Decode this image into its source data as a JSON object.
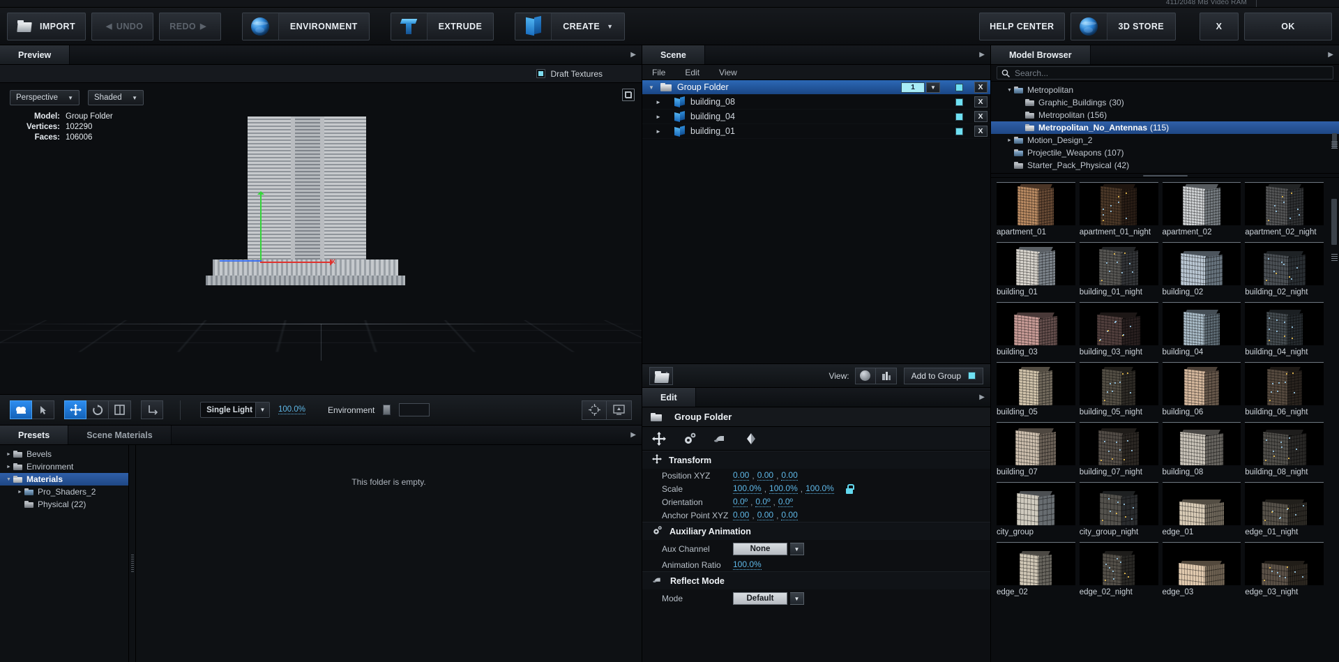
{
  "app": {
    "vram": "411/2048 MB Video RAM"
  },
  "toolbar": {
    "import": "IMPORT",
    "undo": "UNDO",
    "redo": "REDO",
    "environment": "ENVIRONMENT",
    "extrude": "EXTRUDE",
    "create": "CREATE",
    "help_center": "HELP CENTER",
    "store": "3D STORE",
    "close": "X",
    "ok": "OK"
  },
  "preview": {
    "tab": "Preview",
    "draft_textures": "Draft Textures",
    "camera_mode": "Perspective",
    "shading_mode": "Shaded",
    "stats": [
      {
        "key": "Model:",
        "value": "Group Folder"
      },
      {
        "key": "Vertices:",
        "value": "102290"
      },
      {
        "key": "Faces:",
        "value": "106006"
      }
    ],
    "tools": {
      "camera": "camera-tool",
      "select": "select-tool",
      "move": "move-tool",
      "rotate": "rotate-tool",
      "scale": "scale-tool",
      "axis": "axis-tool"
    },
    "light_mode": "Single Light",
    "light_intensity": "100.0%",
    "environment_label": "Environment"
  },
  "scene": {
    "tab": "Scene",
    "menu": [
      "File",
      "Edit",
      "View"
    ],
    "rows": [
      {
        "name": "Group Folder",
        "type": "folder",
        "selected": true,
        "count": "1",
        "has_count": true,
        "indent": 0,
        "expanded": true
      },
      {
        "name": "building_08",
        "type": "mesh",
        "selected": false,
        "has_count": false,
        "indent": 1,
        "expanded": false
      },
      {
        "name": "building_04",
        "type": "mesh",
        "selected": false,
        "has_count": false,
        "indent": 1,
        "expanded": false
      },
      {
        "name": "building_01",
        "type": "mesh",
        "selected": false,
        "has_count": false,
        "indent": 1,
        "expanded": false
      }
    ],
    "close_label": "X",
    "footer": {
      "view_label": "View:",
      "add_to_group": "Add to Group"
    }
  },
  "edit": {
    "tab": "Edit",
    "object_name": "Group Folder",
    "sections": [
      {
        "title": "Transform",
        "icon": "move-icon",
        "rows": [
          {
            "label": "Position XYZ",
            "values": [
              "0.00",
              "0.00",
              "0.00"
            ],
            "suffix": "",
            "lock": false
          },
          {
            "label": "Scale",
            "values": [
              "100.0%",
              "100.0%",
              "100.0%"
            ],
            "suffix": "",
            "lock": true
          },
          {
            "label": "Orientation",
            "values": [
              "0.0º",
              "0.0º",
              "0.0º"
            ],
            "suffix": "",
            "lock": false
          },
          {
            "label": "Anchor Point XYZ",
            "values": [
              "0.00",
              "0.00",
              "0.00"
            ],
            "suffix": "",
            "lock": false
          }
        ]
      },
      {
        "title": "Auxiliary Animation",
        "icon": "gears-icon",
        "dropdown_row": {
          "label": "Aux Channel",
          "value": "None"
        },
        "link_row": {
          "label": "Animation Ratio",
          "value": "100.0%"
        }
      },
      {
        "title": "Reflect Mode",
        "icon": "reflect-icon",
        "dropdown_row": {
          "label": "Mode",
          "value": "Default"
        }
      }
    ]
  },
  "presets": {
    "tabs": [
      {
        "label": "Presets",
        "active": true
      },
      {
        "label": "Scene Materials",
        "active": false
      }
    ],
    "tree": [
      {
        "label": "Bevels",
        "indent": 0,
        "arrow": "right",
        "selected": false,
        "folder": "grey"
      },
      {
        "label": "Environment",
        "indent": 0,
        "arrow": "right",
        "selected": false,
        "folder": "grey"
      },
      {
        "label": "Materials",
        "indent": 0,
        "arrow": "down",
        "selected": true,
        "folder": "open"
      },
      {
        "label": "Pro_Shaders_2",
        "indent": 1,
        "arrow": "right",
        "selected": false,
        "folder": "blue"
      },
      {
        "label": "Physical (22)",
        "indent": 1,
        "arrow": "none",
        "selected": false,
        "folder": "grey"
      }
    ],
    "empty_message": "This folder is empty."
  },
  "model_browser": {
    "tab": "Model Browser",
    "search_placeholder": "Search...",
    "search_value": "",
    "tree": [
      {
        "label": "Metropolitan",
        "count": "",
        "indent": 1,
        "arrow": "down",
        "selected": false,
        "folder": "blue"
      },
      {
        "label": "Graphic_Buildings",
        "count": "(30)",
        "indent": 2,
        "arrow": "none",
        "selected": false,
        "folder": "grey"
      },
      {
        "label": "Metropolitan",
        "count": "(156)",
        "indent": 2,
        "arrow": "none",
        "selected": false,
        "folder": "grey"
      },
      {
        "label": "Metropolitan_No_Antennas",
        "count": "(115)",
        "indent": 2,
        "arrow": "none",
        "selected": true,
        "folder": "open"
      },
      {
        "label": "Motion_Design_2",
        "count": "",
        "indent": 1,
        "arrow": "right",
        "selected": false,
        "folder": "blue"
      },
      {
        "label": "Projectile_Weapons",
        "count": "(107)",
        "indent": 1,
        "arrow": "none",
        "selected": false,
        "folder": "blue"
      },
      {
        "label": "Starter_Pack_Physical",
        "count": "(42)",
        "indent": 1,
        "arrow": "none",
        "selected": false,
        "folder": "grey"
      }
    ],
    "items": [
      {
        "label": "apartment_01",
        "night": false,
        "style": "brick-tall"
      },
      {
        "label": "apartment_01_night",
        "night": true,
        "style": "brick-tall"
      },
      {
        "label": "apartment_02",
        "night": false,
        "style": "pale-tall"
      },
      {
        "label": "apartment_02_night",
        "night": true,
        "style": "pale-tall"
      },
      {
        "label": "building_01",
        "night": false,
        "style": "slab"
      },
      {
        "label": "building_01_night",
        "night": true,
        "style": "slab"
      },
      {
        "label": "building_02",
        "night": false,
        "style": "stepped"
      },
      {
        "label": "building_02_night",
        "night": true,
        "style": "stepped"
      },
      {
        "label": "building_03",
        "night": false,
        "style": "striped"
      },
      {
        "label": "building_03_night",
        "night": true,
        "style": "striped"
      },
      {
        "label": "building_04",
        "night": false,
        "style": "boxy"
      },
      {
        "label": "building_04_night",
        "night": true,
        "style": "boxy"
      },
      {
        "label": "building_05",
        "night": false,
        "style": "round"
      },
      {
        "label": "building_05_night",
        "night": true,
        "style": "round"
      },
      {
        "label": "building_06",
        "night": false,
        "style": "tower"
      },
      {
        "label": "building_06_night",
        "night": true,
        "style": "tower"
      },
      {
        "label": "building_07",
        "night": false,
        "style": "cluster"
      },
      {
        "label": "building_07_night",
        "night": true,
        "style": "cluster"
      },
      {
        "label": "building_08",
        "night": false,
        "style": "wide"
      },
      {
        "label": "building_08_night",
        "night": true,
        "style": "wide"
      },
      {
        "label": "city_group",
        "night": false,
        "style": "wedge"
      },
      {
        "label": "city_group_night",
        "night": true,
        "style": "wedge"
      },
      {
        "label": "edge_01",
        "night": false,
        "style": "low"
      },
      {
        "label": "edge_01_night",
        "night": true,
        "style": "low"
      },
      {
        "label": "edge_02",
        "night": false,
        "style": "mid"
      },
      {
        "label": "edge_02_night",
        "night": true,
        "style": "mid"
      },
      {
        "label": "edge_03",
        "night": false,
        "style": "low-wide"
      },
      {
        "label": "edge_03_night",
        "night": true,
        "style": "low-wide"
      }
    ]
  }
}
